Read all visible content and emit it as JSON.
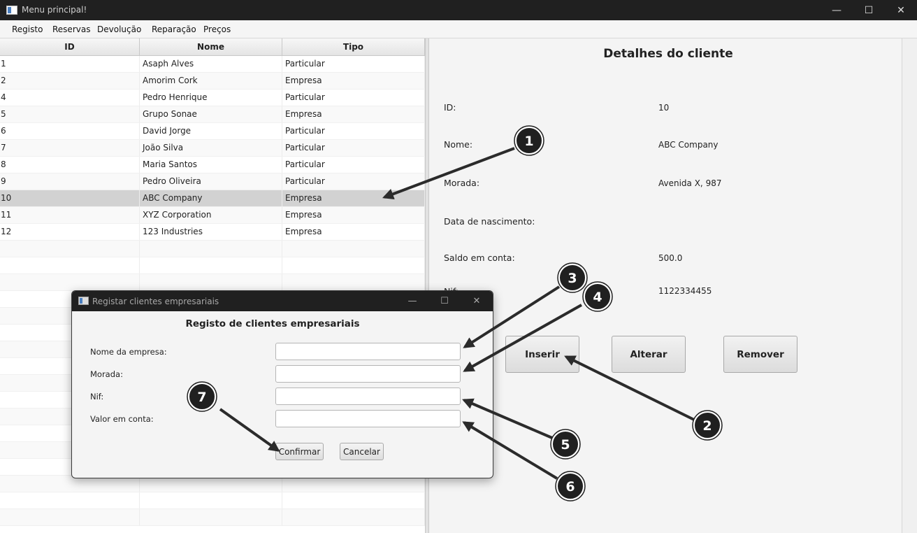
{
  "window": {
    "title": "Menu principal!",
    "controls": {
      "minimize": "—",
      "maximize": "☐",
      "close": "✕"
    }
  },
  "menu": [
    "Registo",
    "Reservas",
    "Devolução",
    "Reparação",
    "Preços"
  ],
  "table": {
    "columns": [
      "ID",
      "Nome",
      "Tipo"
    ],
    "rows": [
      {
        "id": "1",
        "nome": "Asaph Alves",
        "tipo": "Particular"
      },
      {
        "id": "2",
        "nome": "Amorim Cork",
        "tipo": "Empresa"
      },
      {
        "id": "4",
        "nome": "Pedro Henrique",
        "tipo": "Particular"
      },
      {
        "id": "5",
        "nome": "Grupo Sonae",
        "tipo": "Empresa"
      },
      {
        "id": "6",
        "nome": "David Jorge",
        "tipo": "Particular"
      },
      {
        "id": "7",
        "nome": "João Silva",
        "tipo": "Particular"
      },
      {
        "id": "8",
        "nome": "Maria Santos",
        "tipo": "Particular"
      },
      {
        "id": "9",
        "nome": "Pedro Oliveira",
        "tipo": "Particular"
      },
      {
        "id": "10",
        "nome": "ABC Company",
        "tipo": "Empresa"
      },
      {
        "id": "11",
        "nome": "XYZ Corporation",
        "tipo": "Empresa"
      },
      {
        "id": "12",
        "nome": "123 Industries",
        "tipo": "Empresa"
      }
    ],
    "selected_index": 8
  },
  "details": {
    "title": "Detalhes do cliente",
    "fields": [
      {
        "label": "ID:",
        "value": "10"
      },
      {
        "label": "Nome:",
        "value": "ABC Company"
      },
      {
        "label": "Morada:",
        "value": "Avenida X, 987"
      },
      {
        "label": "Data de nascimento:",
        "value": ""
      },
      {
        "label": "Saldo em conta:",
        "value": "500.0"
      },
      {
        "label": "Nif:",
        "value": "1122334455"
      }
    ],
    "buttons": {
      "insert": "Inserir",
      "edit": "Alterar",
      "remove": "Remover"
    }
  },
  "dialog": {
    "title": "Registar clientes empresariais",
    "heading": "Registo de clientes empresariais",
    "fields": [
      {
        "label": "Nome da empresa:",
        "value": ""
      },
      {
        "label": "Morada:",
        "value": ""
      },
      {
        "label": "Nif:",
        "value": ""
      },
      {
        "label": "Valor em conta:",
        "value": ""
      }
    ],
    "buttons": {
      "confirm": "Confirmar",
      "cancel": "Cancelar"
    },
    "controls": {
      "minimize": "—",
      "maximize": "☐",
      "close": "✕"
    }
  },
  "annotations": [
    "1",
    "2",
    "3",
    "4",
    "5",
    "6",
    "7"
  ],
  "colors": {
    "badge_fill": "#202020",
    "arrow": "#2b2b2b",
    "selected_row": "#d2d2d2",
    "titlebar": "#202020"
  }
}
